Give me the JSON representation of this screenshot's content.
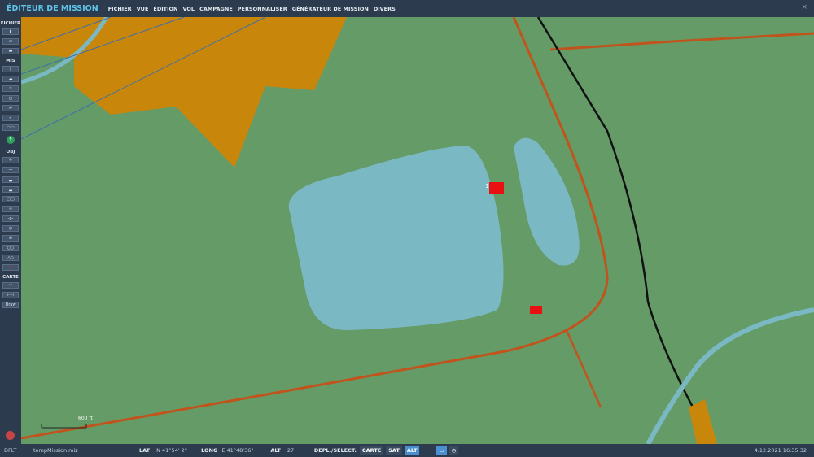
{
  "header": {
    "title": "ÉDITEUR DE MISSION",
    "menus": [
      "FICHIER",
      "VUE",
      "ÉDITION",
      "VOL",
      "CAMPAGNE",
      "PERSONNALISER",
      "GÉNÉRATEUR DE MISSION",
      "DIVERS"
    ],
    "close": "×"
  },
  "sidebar": {
    "sections": [
      "FICHIER",
      "MIS",
      "OBJ",
      "CARTE"
    ],
    "draw_label": "Draw"
  },
  "map": {
    "unit_label": "1",
    "scale_label": "600 ft"
  },
  "status": {
    "profile": "DFLT",
    "file": "tempMission.miz",
    "lat_label": "LAT",
    "lat": "N 41°54' 2\"",
    "long_label": "LONG",
    "long": "E 41°48'36\"",
    "alt_label": "ALT",
    "alt": "27",
    "mode_label": "DEPL./SELECT.",
    "btn_map": "CARTE",
    "btn_sat": "SAT",
    "btn_alt": "ALT",
    "datetime": "4.12.2021 16:35:32"
  },
  "colors": {
    "terrain": "#659b67",
    "water": "#7ab9c4",
    "urban": "#c8860a",
    "road": "#c0541c",
    "rail": "#111111"
  }
}
